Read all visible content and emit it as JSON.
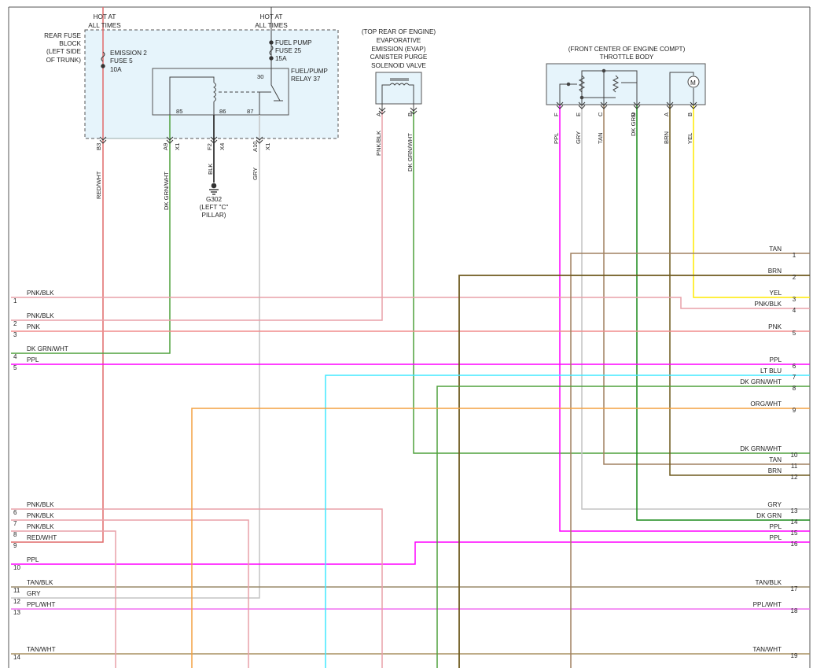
{
  "colors": {
    "PNK/BLK": "#e8a0a8",
    "PNK": "#f08c8c",
    "DK GRN/WHT": "#4ea03c",
    "PPL": "#ff00ff",
    "RED/WHT": "#e06a6a",
    "TAN/BLK": "#9a8a6a",
    "GRY": "#c4c4c4",
    "PPL/WHT": "#f070f0",
    "TAN/WHT": "#a89060",
    "TAN": "#a08060",
    "BRN": "#6e5a1e",
    "YEL": "#ffea00",
    "LT BLU": "#40e8ff",
    "DK GRN": "#1a8a1a",
    "ORG/WHT": "#f4a040",
    "BLK": "#333333",
    "box_fill": "#e6f4fb",
    "box_border": "#555555"
  },
  "header": {
    "hot1": [
      "HOT AT",
      "ALL TIMES"
    ],
    "hot2": [
      "HOT AT",
      "ALL TIMES"
    ]
  },
  "fuse_block": {
    "label": [
      "REAR FUSE",
      "BLOCK",
      "(LEFT SIDE",
      "OF TRUNK)"
    ],
    "fuse1": [
      "EMISSION 2",
      "FUSE 5",
      "10A"
    ],
    "fuse2": [
      "FUEL PUMP",
      "FUSE 25",
      "15A"
    ],
    "relay": [
      "FUEL/PUMP",
      "RELAY 37"
    ],
    "relay_pins": [
      "85",
      "86",
      "87",
      "30"
    ],
    "pins": [
      "B3",
      "A9",
      "F2",
      "A10"
    ],
    "conn": [
      "X1",
      "X4",
      "X1"
    ]
  },
  "ground": {
    "wire": "BLK",
    "label": [
      "G302",
      "(LEFT \"C\"",
      "PILLAR)"
    ]
  },
  "evap": {
    "title": [
      "(TOP REAR OF ENGINE)",
      "EVAPORATIVE",
      "EMISSION (EVAP)",
      "CANISTER PURGE",
      "SOLENOID VALVE"
    ],
    "pins": [
      "A",
      "B"
    ],
    "wires": [
      "PNK/BLK",
      "DK GRN/WHT"
    ]
  },
  "throttle": {
    "title": [
      "(FRONT CENTER OF ENGINE COMPT)",
      "THROTTLE BODY"
    ],
    "pins": [
      "F",
      "E",
      "C",
      "D",
      "A",
      "B"
    ],
    "wires": [
      "PPL",
      "GRY",
      "TAN",
      "DK GRN",
      "BRN",
      "YEL"
    ],
    "motor": "M"
  },
  "fuse_wires": [
    "RED/WHT",
    "DK GRN/WHT",
    "GRY"
  ],
  "left_wires": [
    {
      "num": "1",
      "label": "PNK/BLK"
    },
    {
      "num": "2",
      "label": "PNK/BLK"
    },
    {
      "num": "3",
      "label": "PNK"
    },
    {
      "num": "4",
      "label": "DK GRN/WHT"
    },
    {
      "num": "5",
      "label": "PPL"
    },
    {
      "num": "6",
      "label": "PNK/BLK"
    },
    {
      "num": "7",
      "label": "PNK/BLK"
    },
    {
      "num": "8",
      "label": "PNK/BLK"
    },
    {
      "num": "9",
      "label": "RED/WHT"
    },
    {
      "num": "10",
      "label": "PPL"
    },
    {
      "num": "11",
      "label": "TAN/BLK"
    },
    {
      "num": "12",
      "label": "GRY"
    },
    {
      "num": "13",
      "label": "PPL/WHT"
    },
    {
      "num": "14",
      "label": "TAN/WHT"
    }
  ],
  "right_wires": [
    {
      "num": "1",
      "label": "TAN"
    },
    {
      "num": "2",
      "label": "BRN"
    },
    {
      "num": "3",
      "label": "YEL"
    },
    {
      "num": "4",
      "label": "PNK/BLK"
    },
    {
      "num": "5",
      "label": "PNK"
    },
    {
      "num": "6",
      "label": "PPL"
    },
    {
      "num": "7",
      "label": "LT BLU"
    },
    {
      "num": "8",
      "label": "DK GRN/WHT"
    },
    {
      "num": "9",
      "label": "ORG/WHT"
    },
    {
      "num": "10",
      "label": "DK GRN/WHT"
    },
    {
      "num": "11",
      "label": "TAN"
    },
    {
      "num": "12",
      "label": "BRN"
    },
    {
      "num": "13",
      "label": "GRY"
    },
    {
      "num": "14",
      "label": "DK GRN"
    },
    {
      "num": "15",
      "label": "PPL"
    },
    {
      "num": "16",
      "label": "PPL"
    },
    {
      "num": "17",
      "label": "TAN/BLK"
    },
    {
      "num": "18",
      "label": "PPL/WHT"
    },
    {
      "num": "19",
      "label": "TAN/WHT"
    }
  ]
}
